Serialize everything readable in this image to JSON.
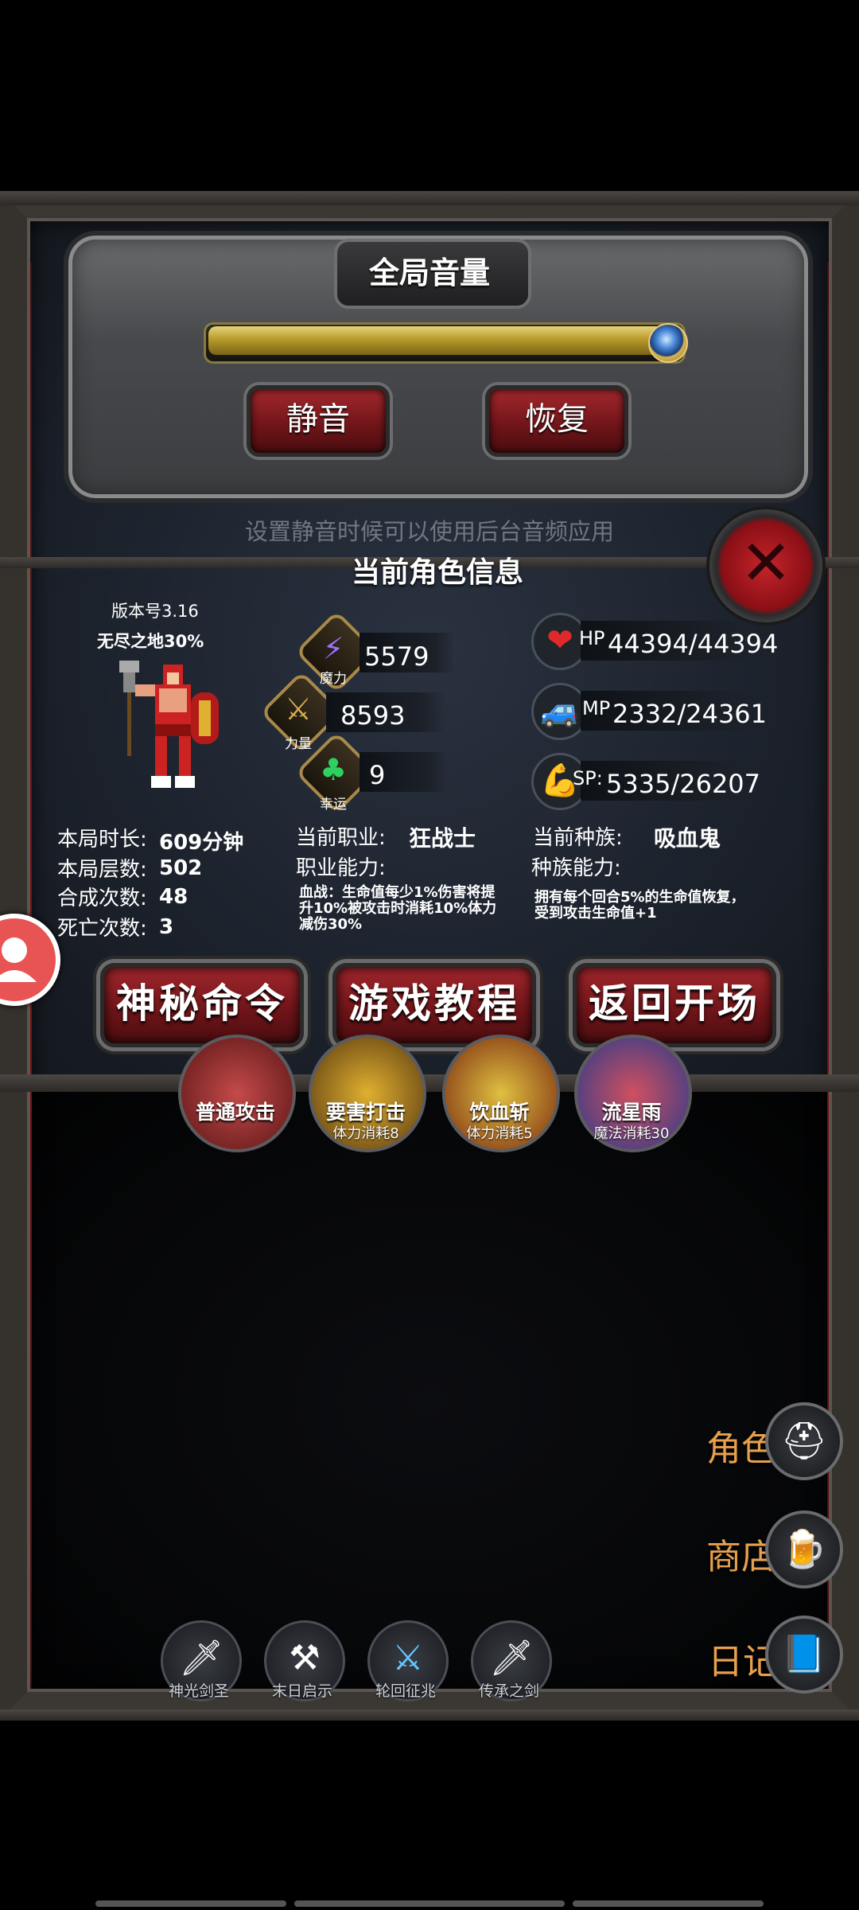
{
  "volume": {
    "title": "全局音量",
    "level_fraction": 0.98,
    "mute_label": "静音",
    "restore_label": "恢复",
    "hint": "设置静音时候可以使用后台音频应用"
  },
  "character": {
    "section_title": "当前角色信息",
    "version": "版本号3.16",
    "endless": "无尽之地30%",
    "stats": [
      {
        "key": "magic",
        "caption": "魔力",
        "value": "5579",
        "icon": "lightning-icon"
      },
      {
        "key": "strength",
        "caption": "力量",
        "value": "8593",
        "icon": "sword-icon"
      },
      {
        "key": "luck",
        "caption": "幸运",
        "value": "9",
        "icon": "clover-icon"
      }
    ],
    "hp": {
      "prefix": "HP",
      "value": "44394/44394",
      "icon": "heart-icon",
      "color": "#e02a2a"
    },
    "mp": {
      "prefix": "MP",
      "value": "2332/24361",
      "icon": "car-icon",
      "color": "#3a7fd0"
    },
    "sp": {
      "prefix": "SP:",
      "value": "5335/26207",
      "icon": "strongman-icon",
      "color": "#d8b830"
    },
    "run_stats": [
      {
        "label": "本局时长:",
        "value": "609分钟"
      },
      {
        "label": "本局层数:",
        "value": "502"
      },
      {
        "label": "合成次数:",
        "value": "48"
      },
      {
        "label": "死亡次数:",
        "value": "3"
      }
    ],
    "class_label": "当前职业:",
    "class_value": "狂战士",
    "class_ability_label": "职业能力:",
    "class_ability_text": "血战：生命值每少1%伤害将提升10%被攻击时消耗10%体力减伤30%",
    "race_label": "当前种族:",
    "race_value": "吸血鬼",
    "race_ability_label": "种族能力:",
    "race_ability_text": "拥有每个回合5%的生命值恢复，受到攻击生命值+1"
  },
  "actions": {
    "mystery": "神秘命令",
    "tutorial": "游戏教程",
    "back": "返回开场"
  },
  "skills": [
    {
      "name": "普通攻击",
      "cost": "",
      "color": "#8a2a2a"
    },
    {
      "name": "要害打击",
      "cost": "体力消耗8",
      "color": "#6a4a1a"
    },
    {
      "name": "饮血斩",
      "cost": "体力消耗5",
      "color": "#7a3a14"
    },
    {
      "name": "流星雨",
      "cost": "魔法消耗30",
      "color": "#3a3a7a"
    }
  ],
  "side_menu": {
    "role": "角色",
    "shop": "商店",
    "diary": "日记"
  },
  "loot": [
    {
      "name": "神光剑圣",
      "icon": "knight-icon"
    },
    {
      "name": "末日启示",
      "icon": "crossed-axes-icon"
    },
    {
      "name": "轮回征兆",
      "icon": "blue-sword-icon"
    },
    {
      "name": "传承之剑",
      "icon": "sword-icon"
    }
  ]
}
